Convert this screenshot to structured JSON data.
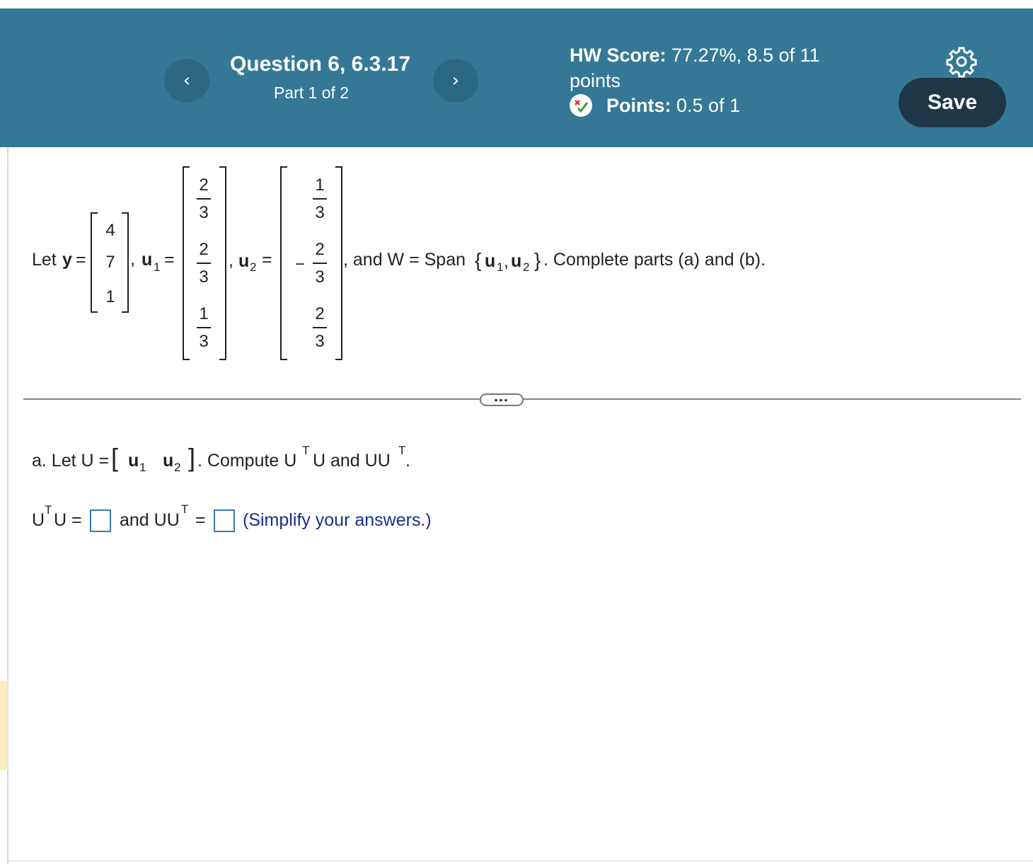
{
  "header": {
    "question_title": "Question 6, 6.3.17",
    "part_label": "Part 1 of 2",
    "hw_score_label": "HW Score:",
    "hw_score_value": "77.27%, 8.5 of 11",
    "hw_score_unit": "points",
    "points_label": "Points:",
    "points_value": "0.5 of 1",
    "prev_icon": "chevron-left-icon",
    "next_icon": "chevron-right-icon",
    "settings_icon": "gear-icon",
    "save_label": "Save"
  },
  "problem": {
    "let_text": "Let",
    "y_sym": "y",
    "eq": "=",
    "comma": ",",
    "u_sym": "u",
    "sub_1": "1",
    "sub_2": "2",
    "y_vector": [
      "4",
      "7",
      "1"
    ],
    "u1_vector": [
      {
        "num": "2",
        "den": "3",
        "neg": ""
      },
      {
        "num": "2",
        "den": "3",
        "neg": ""
      },
      {
        "num": "1",
        "den": "3",
        "neg": ""
      }
    ],
    "u2_vector": [
      {
        "num": "1",
        "den": "3",
        "neg": ""
      },
      {
        "num": "2",
        "den": "3",
        "neg": "−"
      },
      {
        "num": "2",
        "den": "3",
        "neg": ""
      }
    ],
    "span_text": ", and W = Span",
    "brace_open": "{",
    "brace_close": "}",
    "trailing": ". Complete parts (a) and (b)."
  },
  "more_button": "•••",
  "part_a": {
    "lead": "a. Let U =",
    "compute": ". Compute U",
    "and_text": "U and UU",
    "period": ".",
    "sup_t": "T",
    "ans_u": "U",
    "ans_u_end": "U =",
    "ans_and": "and UU",
    "ans_eq": "=",
    "hint": "(Simplify your answers.)"
  },
  "colors": {
    "header_bg": "#357896",
    "nav_button": "#2d6883",
    "save_bg": "#1e3645",
    "answer_box_border": "#3c78b4",
    "hint_text": "#1a2f8c"
  }
}
